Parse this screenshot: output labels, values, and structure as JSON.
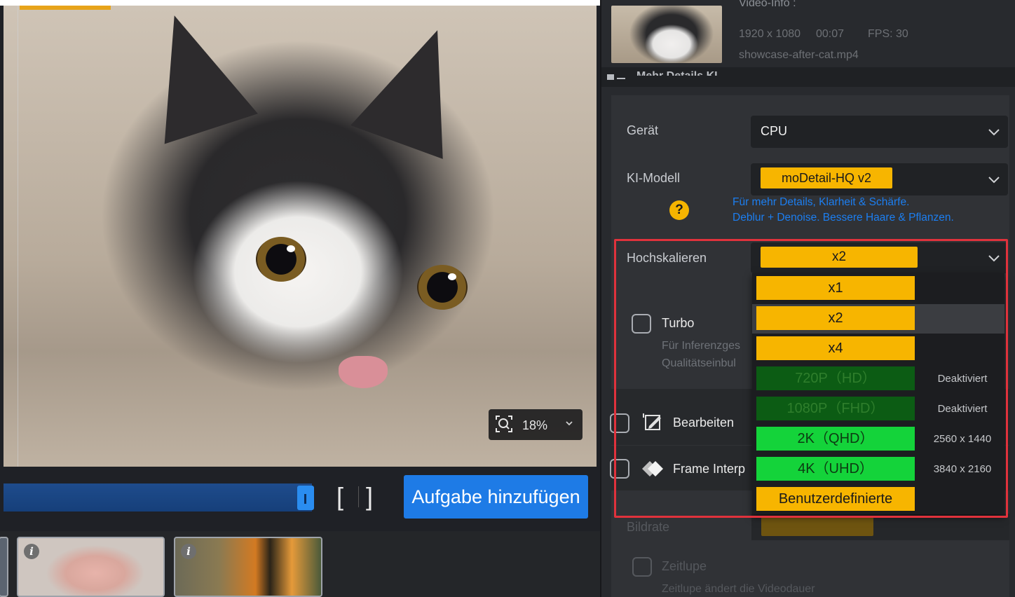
{
  "preview": {
    "zoom_value": "18%"
  },
  "timeline": {
    "bracket_in": "[",
    "bracket_out": "]",
    "add_task_label": "Aufgabe hinzufügen"
  },
  "video_info": {
    "heading": "Video-Info :",
    "resolution": "1920 x 1080",
    "duration": "00:07",
    "fps": "FPS: 30",
    "filename": "showcase-after-cat.mp4"
  },
  "details_section": {
    "label": "Mehr Details KI"
  },
  "settings": {
    "device": {
      "label": "Gerät",
      "value": "CPU"
    },
    "model": {
      "label": "KI-Modell",
      "value": "moDetail-HQ  v2",
      "hint_line1": "Für mehr Details, Klarheit & Schärfe.",
      "hint_line2": "Deblur + Denoise. Bessere Haare & Pflanzen."
    },
    "help_glyph": "?",
    "upscale": {
      "label": "Hochskalieren",
      "value": "x2"
    },
    "turbo": {
      "label": "Turbo",
      "desc_line1": "Für Inferenzges",
      "desc_line2": "Qualitätseinbul"
    },
    "edit": {
      "label": "Bearbeiten"
    },
    "frame_interp": {
      "label": "Frame Interp"
    },
    "framerate": {
      "label": "Bildrate"
    },
    "slowmo": {
      "label": "Zeitlupe",
      "desc": "Zeitlupe ändert die Videodauer"
    }
  },
  "dropdown": {
    "options": [
      {
        "label": "x1",
        "note": "",
        "state": "enabled",
        "color": "#f7b500"
      },
      {
        "label": "x2",
        "note": "",
        "state": "selected",
        "color": "#f7b500"
      },
      {
        "label": "x4",
        "note": "",
        "state": "enabled",
        "color": "#f7b500"
      },
      {
        "label": "720P（HD）",
        "note": "Deaktiviert",
        "state": "disabled",
        "color": "#0c5c14"
      },
      {
        "label": "1080P（FHD）",
        "note": "Deaktiviert",
        "state": "disabled",
        "color": "#0c5c14"
      },
      {
        "label": "2K（QHD）",
        "note": "2560 x 1440",
        "state": "enabled",
        "color": "#14d33a"
      },
      {
        "label": "4K（UHD）",
        "note": "3840 x 2160",
        "state": "enabled",
        "color": "#14d33a"
      },
      {
        "label": "Benutzerdefinierte",
        "note": "",
        "state": "enabled",
        "color": "#f7b500"
      }
    ]
  },
  "thumbnails": {
    "info_glyph": "i"
  },
  "colors": {
    "accent_blue": "#1e7be6",
    "accent_yellow": "#f7b500",
    "highlight_red": "#e0323c",
    "option_green": "#14d33a",
    "option_disabled_green": "#0c5c14"
  }
}
